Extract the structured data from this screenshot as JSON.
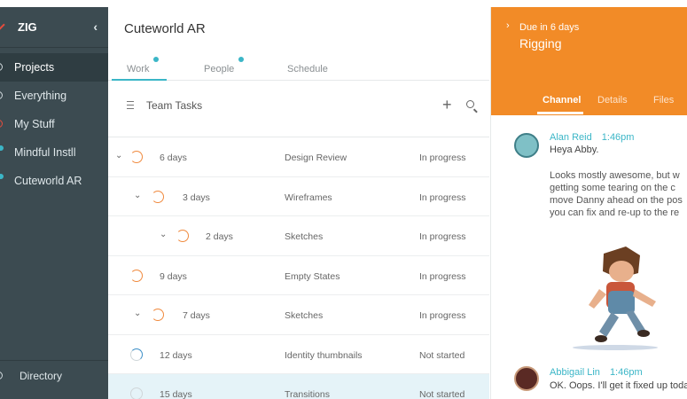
{
  "sidebar": {
    "brand": "ZIG",
    "items": [
      {
        "label": "Projects"
      },
      {
        "label": "Everything"
      },
      {
        "label": "My Stuff"
      },
      {
        "label": "Mindful Instll"
      },
      {
        "label": "Cuteworld AR"
      }
    ],
    "directory": "Directory"
  },
  "main": {
    "project_title": "Cuteworld AR",
    "tabs": [
      {
        "label": "Work"
      },
      {
        "label": "People"
      },
      {
        "label": "Schedule"
      }
    ],
    "section_title": "Team Tasks",
    "tasks": [
      {
        "days": "6 days",
        "name": "Design Review",
        "status": "In progress"
      },
      {
        "days": "3 days",
        "name": "Wireframes",
        "status": "In progress"
      },
      {
        "days": "2 days",
        "name": "Sketches",
        "status": "In progress"
      },
      {
        "days": "9 days",
        "name": "Empty States",
        "status": "In progress"
      },
      {
        "days": "7 days",
        "name": "Sketches",
        "status": "In progress"
      },
      {
        "days": "12 days",
        "name": "Identity thumbnails",
        "status": "Not started"
      },
      {
        "days": "15 days",
        "name": "Transitions",
        "status": "Not started"
      }
    ]
  },
  "detail": {
    "due": "Due in 6 days",
    "title": "Rigging",
    "tabs": [
      {
        "label": "Channel"
      },
      {
        "label": "Details"
      },
      {
        "label": "Files"
      }
    ],
    "messages": [
      {
        "author": "Alan Reid",
        "time": "1:46pm",
        "text": "Heya Abby."
      },
      {
        "author": "Abbigail Lin",
        "time": "1:46pm",
        "text": "OK. Oops. I'll get it fixed up toda"
      }
    ],
    "body_lines": [
      "Looks mostly awesome, but w",
      "getting some tearing on the c",
      "move Danny ahead on the pos",
      "you can fix and re-up to the re"
    ]
  },
  "colors": {
    "sidebar_bg": "#3c4b51",
    "accent_teal": "#3bb6c7",
    "detail_header": "#f28b27",
    "progress_ring": "#f0893d"
  }
}
